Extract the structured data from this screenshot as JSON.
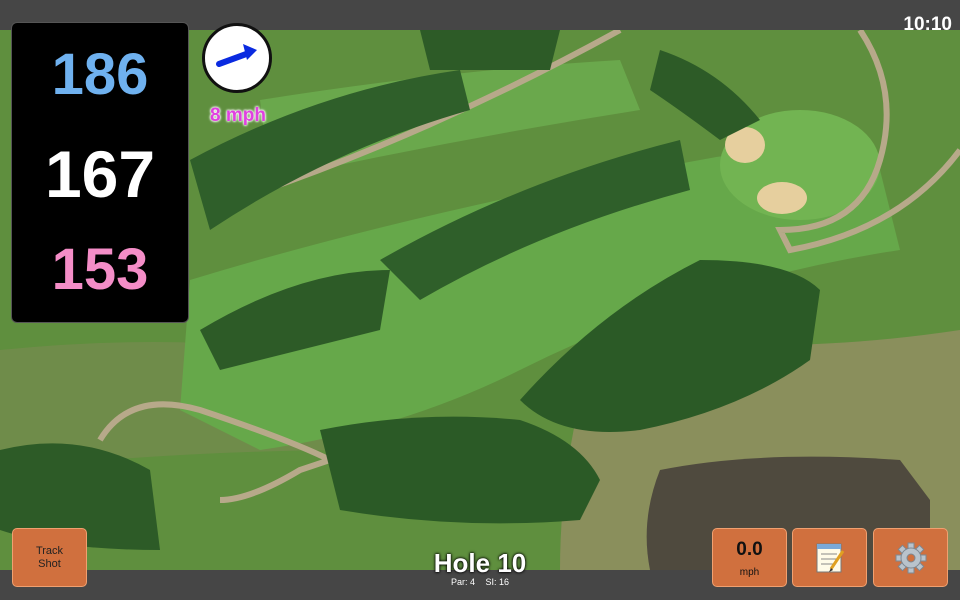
{
  "status": {
    "clock": "10:10"
  },
  "yardages": {
    "back": "186",
    "middle": "167",
    "front": "153"
  },
  "wind": {
    "speed": "8 mph",
    "direction_deg": 70
  },
  "hole": {
    "title": "Hole 10",
    "par": "Par: 4",
    "stroke_index": "SI: 16"
  },
  "buttons": {
    "track_shot_line1": "Track",
    "track_shot_line2": "Shot",
    "speed_value": "0.0",
    "speed_unit": "mph",
    "notes_icon": "notepad-icon",
    "settings_icon": "gear-icon"
  },
  "colors": {
    "back_yardage": "#6fb1ef",
    "middle_yardage": "#ffffff",
    "front_yardage": "#f48dc7",
    "button_bg": "#d0703e",
    "wind_text": "#e040e0"
  }
}
